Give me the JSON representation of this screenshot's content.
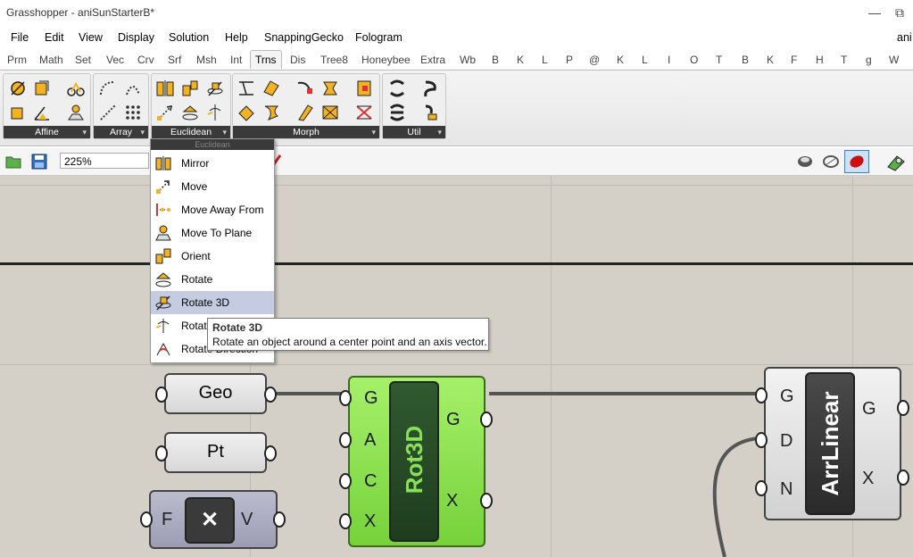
{
  "window": {
    "title": "Grasshopper - aniSunStarterB*",
    "minimize": "—",
    "restore": "⧉"
  },
  "menubar": {
    "items": [
      "File",
      "Edit",
      "View",
      "Display",
      "Solution",
      "Help",
      "SnappingGecko",
      "Fologram"
    ],
    "right_text": "ani"
  },
  "tabs": {
    "items": [
      "Prm",
      "Math",
      "Set",
      "Vec",
      "Crv",
      "Srf",
      "Msh",
      "Int",
      "Trns",
      "Dis",
      "Tree8",
      "Honeybee",
      "Extra",
      "Wb",
      "B",
      "K",
      "L",
      "P",
      "@",
      "K",
      "L",
      "I",
      "O",
      "T",
      "B",
      "K",
      "F",
      "H",
      "T",
      "g",
      "W"
    ],
    "active": "Trns"
  },
  "ribbon": {
    "panels": [
      {
        "label": "Affine"
      },
      {
        "label": "Array"
      },
      {
        "label": "Euclidean"
      },
      {
        "label": "Morph"
      },
      {
        "label": "Util"
      }
    ]
  },
  "toolbar": {
    "zoom": "225%"
  },
  "dropdown": {
    "header": "Euclidean",
    "items": [
      {
        "label": "Mirror",
        "icon": "mirror-icon"
      },
      {
        "label": "Move",
        "icon": "move-icon"
      },
      {
        "label": "Move Away From",
        "icon": "move-away-icon"
      },
      {
        "label": "Move To Plane",
        "icon": "move-to-plane-icon"
      },
      {
        "label": "Orient",
        "icon": "orient-icon"
      },
      {
        "label": "Rotate",
        "icon": "rotate-icon"
      },
      {
        "label": "Rotate 3D",
        "icon": "rotate-3d-icon"
      },
      {
        "label": "Rotate",
        "icon": "rotate-axis-icon"
      },
      {
        "label": "Rotate Direction",
        "icon": "rotate-direction-icon"
      }
    ],
    "selected": "Rotate 3D"
  },
  "tooltip": {
    "title": "Rotate 3D",
    "description": "Rotate an object around a center point and an axis vector."
  },
  "canvas": {
    "params": [
      {
        "label": "Geo"
      },
      {
        "label": "Pt"
      }
    ],
    "toggle": {
      "left": "F",
      "center": "✕",
      "right": "V"
    },
    "rot3d": {
      "name": "Rot3D",
      "inputs": [
        "G",
        "A",
        "C",
        "X"
      ],
      "outputs": [
        "G",
        "X"
      ],
      "color": "#88e04a"
    },
    "arrlinear": {
      "name": "ArrLinear",
      "inputs": [
        "G",
        "D",
        "N"
      ],
      "outputs": [
        "G",
        "X"
      ]
    }
  },
  "colors": {
    "canvas": "#d4d0c8",
    "selected_item": "#c5cbe0",
    "component_green": "#88e04a"
  }
}
